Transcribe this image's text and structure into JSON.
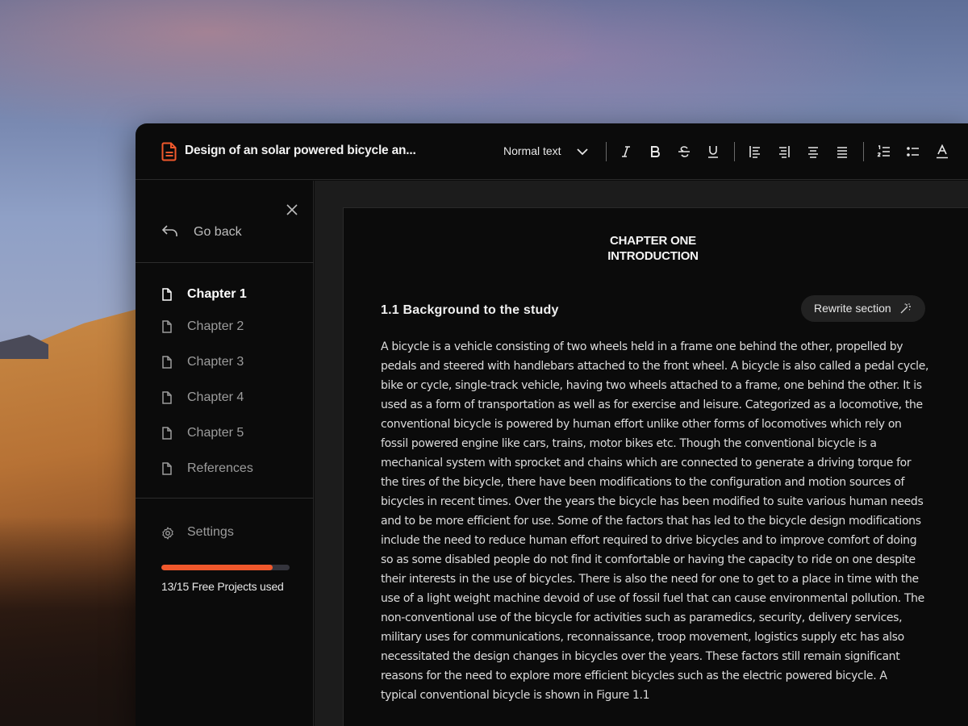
{
  "document": {
    "title": "Design of an solar powered bicycle an..."
  },
  "toolbar": {
    "text_style": "Normal text",
    "buttons": [
      {
        "name": "italic-button",
        "icon": "italic-icon"
      },
      {
        "name": "bold-button",
        "icon": "bold-icon"
      },
      {
        "name": "strikethrough-button",
        "icon": "strikethrough-icon"
      },
      {
        "name": "underline-button",
        "icon": "underline-icon"
      },
      {
        "name": "align-left-button",
        "icon": "align-left-icon"
      },
      {
        "name": "align-right-button",
        "icon": "align-right-icon"
      },
      {
        "name": "align-center-button",
        "icon": "align-center-icon"
      },
      {
        "name": "align-justify-button",
        "icon": "align-justify-icon"
      },
      {
        "name": "numbered-list-button",
        "icon": "numbered-list-icon"
      },
      {
        "name": "bullet-list-button",
        "icon": "bullet-list-icon"
      },
      {
        "name": "text-color-button",
        "icon": "text-color-icon"
      }
    ]
  },
  "sidebar": {
    "go_back": "Go back",
    "items": [
      {
        "label": "Chapter 1",
        "active": true
      },
      {
        "label": "Chapter 2",
        "active": false
      },
      {
        "label": "Chapter 3",
        "active": false
      },
      {
        "label": "Chapter 4",
        "active": false
      },
      {
        "label": "Chapter 5",
        "active": false
      },
      {
        "label": "References",
        "active": false
      }
    ],
    "settings": "Settings",
    "usage": {
      "used": 13,
      "total": 15,
      "text": "13/15 Free Projects used"
    }
  },
  "page": {
    "chapter_line1": "CHAPTER ONE",
    "chapter_line2": "INTRODUCTION",
    "section_title": "1.1 Background to the study",
    "rewrite_label": "Rewrite section",
    "body_lines": [
      "A bicycle is a vehicle consisting of two wheels held in a frame one behind the other, propelled by",
      "pedals and steered with handlebars attached to the front wheel. A bicycle is also called a pedal cycle,",
      "bike or cycle, single-track vehicle, having two wheels attached to a frame, one behind the other. It is",
      "used as a form of transportation as well as for exercise and leisure. Categorized as a locomotive, the",
      "conventional bicycle is powered by human effort unlike other forms of locomotives which rely on",
      "fossil powered engine like cars, trains, motor bikes etc. Though the conventional bicycle is a",
      "mechanical system with sprocket and chains which are connected to generate a driving torque for",
      "the tires of the bicycle, there have been modifications to the configuration and motion sources of",
      "bicycles in recent times. Over the years the bicycle has been modified to suite various human needs",
      "and to be more efficient for use. Some of the factors that has led to the bicycle design modifications",
      "include the need to reduce human effort required to drive bicycles and to improve comfort of doing",
      "so as some disabled people do not find it comfortable or having the capacity to ride on one despite",
      "their interests in the use of bicycles. There is also the need for one to get to a place in time with the",
      "use of a light weight machine devoid of use of fossil fuel that can cause environmental pollution. The",
      "non-conventional use of the bicycle for activities such as paramedics, security, delivery services,",
      "military uses for communications, reconnaissance, troop movement, logistics supply etc has also",
      "necessitated the design changes in bicycles over the years. These factors still remain significant",
      "reasons for the need to explore more efficient bicycles such as the electric powered bicycle.  A",
      "typical conventional bicycle is shown in Figure 1.1"
    ]
  },
  "colors": {
    "accent": "#f0582c",
    "window_bg": "#0b0b0b",
    "editor_bg": "#1c1c1c"
  }
}
